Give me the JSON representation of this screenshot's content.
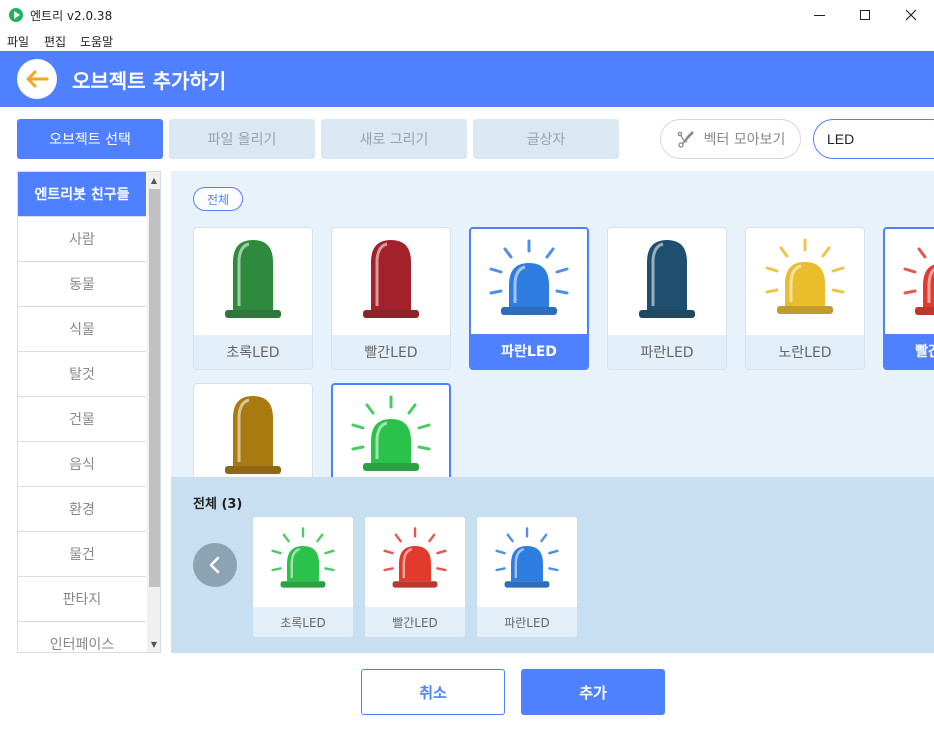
{
  "window": {
    "title": "엔트리 v2.0.38"
  },
  "menu": [
    "파일",
    "편집",
    "도움말"
  ],
  "header": {
    "title": "오브젝트 추가하기"
  },
  "tabs": [
    {
      "label": "오브젝트 선택",
      "active": true
    },
    {
      "label": "파일 올리기",
      "active": false
    },
    {
      "label": "새로 그리기",
      "active": false
    },
    {
      "label": "글상자",
      "active": false
    }
  ],
  "vector_button": {
    "label": "벡터 모아보기"
  },
  "search": {
    "value": "LED"
  },
  "sidebar": {
    "items": [
      {
        "label": "엔트리봇 친구들",
        "active": true
      },
      {
        "label": "사람"
      },
      {
        "label": "동물"
      },
      {
        "label": "식물"
      },
      {
        "label": "탈것"
      },
      {
        "label": "건물"
      },
      {
        "label": "음식"
      },
      {
        "label": "환경"
      },
      {
        "label": "물건"
      },
      {
        "label": "판타지"
      },
      {
        "label": "인터페이스"
      }
    ]
  },
  "filter": {
    "label": "전체"
  },
  "objects": [
    {
      "label": "초록LED",
      "color": "#2e8b3e",
      "style": "dome",
      "selected": false
    },
    {
      "label": "빨간LED",
      "color": "#a3212a",
      "style": "dome",
      "selected": false
    },
    {
      "label": "파란LED",
      "color": "#2f7de1",
      "style": "lit",
      "selected": true
    },
    {
      "label": "파란LED",
      "color": "#1f4f6e",
      "style": "dome",
      "selected": false
    },
    {
      "label": "노란LED",
      "color": "#e9bd2c",
      "style": "lit",
      "selected": false
    },
    {
      "label": "빨간LED",
      "color": "#e23b2e",
      "style": "lit",
      "selected": true
    },
    {
      "label": "",
      "color": "#a87a10",
      "style": "dome",
      "selected": false
    },
    {
      "label": "",
      "color": "#2bc24b",
      "style": "lit",
      "selected": true
    }
  ],
  "tray": {
    "title": "전체 (3)",
    "items": [
      {
        "label": "초록LED",
        "color": "#2bc24b"
      },
      {
        "label": "빨간LED",
        "color": "#e23b2e"
      },
      {
        "label": "파란LED",
        "color": "#2f7de1"
      }
    ]
  },
  "footer": {
    "cancel": "취소",
    "add": "추가"
  }
}
